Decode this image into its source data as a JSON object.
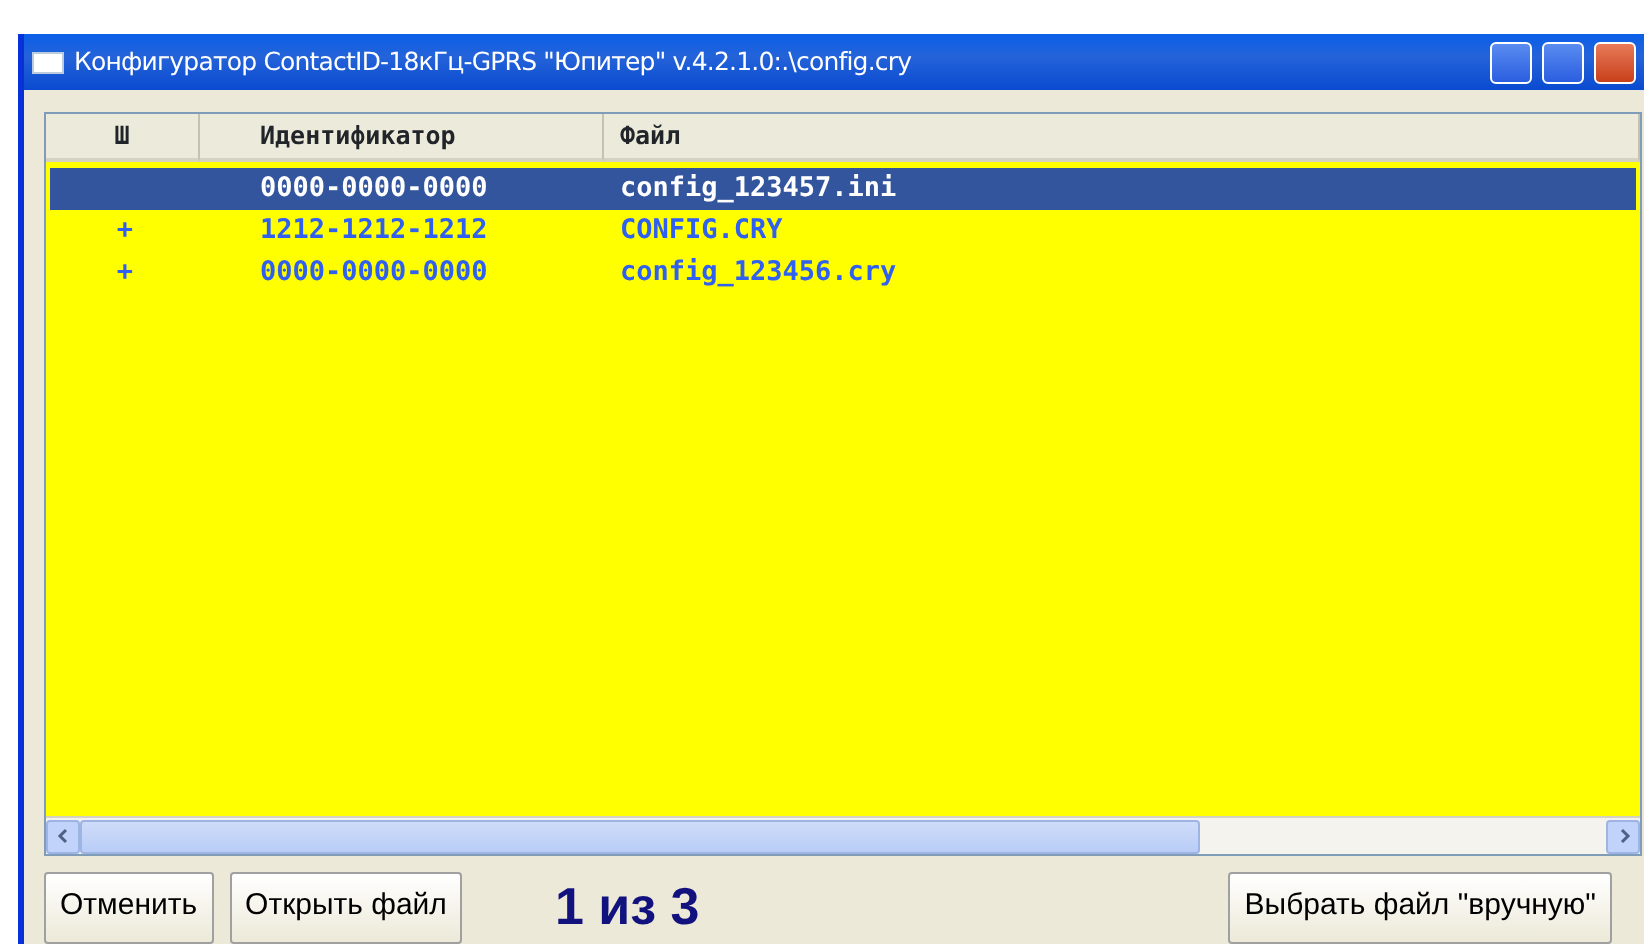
{
  "window": {
    "title": "Конфигуратор ContactID-18кГц-GPRS \"Юпитер\" v.4.2.1.0:.\\config.cry"
  },
  "table": {
    "columns": [
      "Ш",
      "Идентификатор",
      "Файл"
    ],
    "rows": [
      {
        "id": "0000-0000-0000",
        "file": "config_123457.ini",
        "selected": true
      },
      {
        "mark": "+",
        "id": "1212-1212-1212",
        "file": "CONFIG.CRY",
        "selected": false
      },
      {
        "mark": "+",
        "id": "0000-0000-0000",
        "file": "config_123456.cry",
        "selected": false
      }
    ]
  },
  "buttons": [
    {
      "label": "Отменить"
    },
    {
      "label": "Открыть файл"
    }
  ],
  "counter": "1 из 3",
  "manual_button": {
    "label": "Выбрать файл \"вручную\""
  }
}
